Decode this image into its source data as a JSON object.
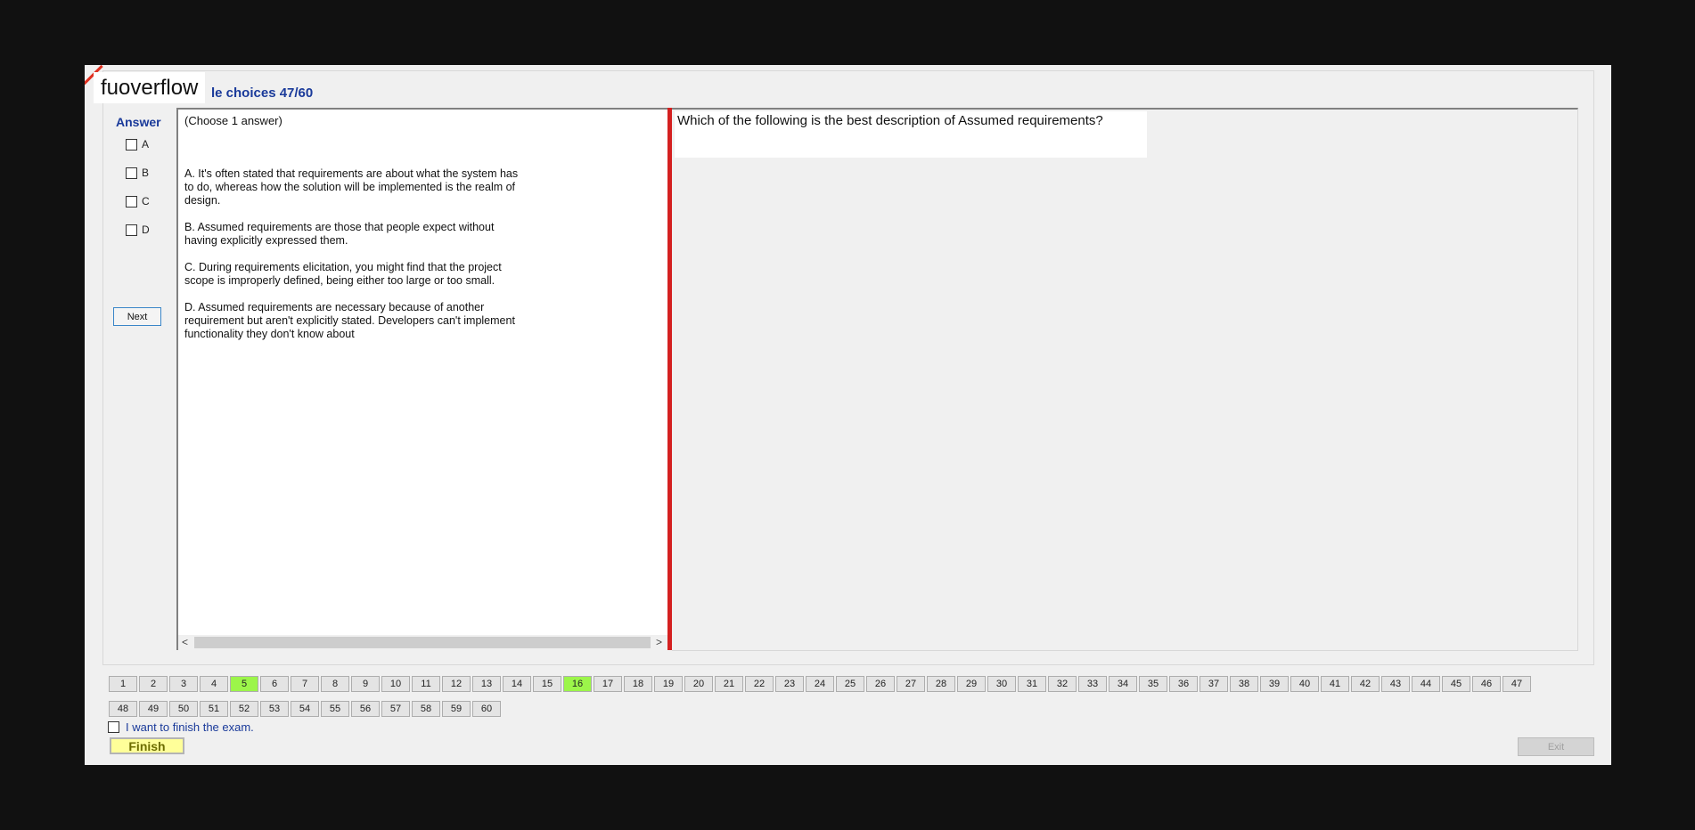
{
  "app": {
    "logo_text": "fuoverflow",
    "header_title": "le choices 47/60"
  },
  "answer_panel": {
    "label": "Answer",
    "options": [
      "A",
      "B",
      "C",
      "D"
    ],
    "next_label": "Next"
  },
  "question_pane": {
    "instruction": "(Choose 1 answer)",
    "choices": [
      "A.  It's often stated that requirements are about what the system has\nto do, whereas how the solution will be implemented is the realm of\ndesign.",
      "B.  Assumed requirements are those that people expect without\nhaving explicitly expressed them.",
      "C.  During requirements elicitation, you might find that the project\nscope is improperly defined, being either too large or too small.",
      "D.  Assumed requirements are necessary because of another\nrequirement but aren't explicitly stated. Developers can't implement\nfunctionality they don't know about"
    ],
    "scroll_left": "<",
    "scroll_right": ">"
  },
  "question_text": "Which of the following is the best description of Assumed requirements?",
  "navigator": {
    "row1": [
      "1",
      "2",
      "3",
      "4",
      "5",
      "6",
      "7",
      "8",
      "9",
      "10",
      "11",
      "12",
      "13",
      "14",
      "15",
      "16",
      "17",
      "18",
      "19",
      "20",
      "21",
      "22",
      "23",
      "24",
      "25",
      "26",
      "27",
      "28",
      "29",
      "30",
      "31",
      "32",
      "33",
      "34",
      "35",
      "36",
      "37",
      "38",
      "39",
      "40",
      "41",
      "42",
      "43",
      "44",
      "45",
      "46",
      "47"
    ],
    "row2": [
      "48",
      "49",
      "50",
      "51",
      "52",
      "53",
      "54",
      "55",
      "56",
      "57",
      "58",
      "59",
      "60"
    ],
    "highlighted": [
      "5",
      "16"
    ],
    "highlight_color": "#9cf54a"
  },
  "footer": {
    "finish_checkbox_label": "I want to finish the exam.",
    "finish_label": "Finish",
    "exit_label": "Exit"
  }
}
